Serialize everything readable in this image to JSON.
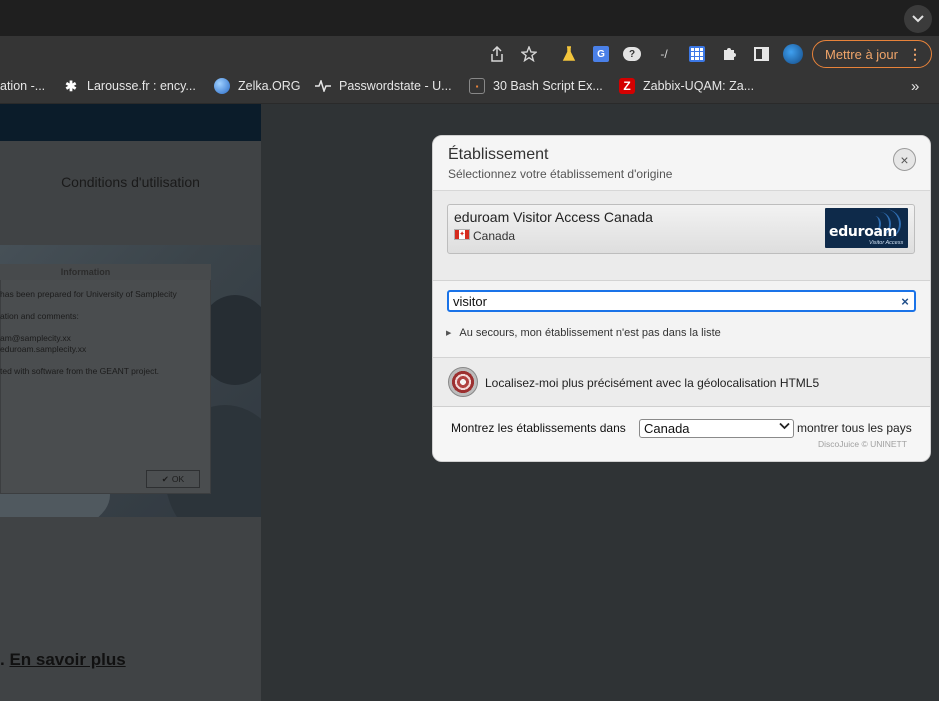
{
  "toolbar": {
    "update_label": "Mettre à jour",
    "icons": [
      "share-icon",
      "star-icon",
      "flask-icon",
      "translate-icon",
      "help-cloud-icon",
      "dash-icon",
      "grid-icon",
      "puzzle-icon",
      "sidepanel-icon",
      "profile-icon"
    ]
  },
  "bookmarks": [
    {
      "label": "ation -...",
      "icon": "none"
    },
    {
      "label": "Larousse.fr : ency...",
      "icon": "asterisk-icon"
    },
    {
      "label": "Zelka.ORG",
      "icon": "globe-icon"
    },
    {
      "label": "Passwordstate - U...",
      "icon": "pulse-icon"
    },
    {
      "label": "30 Bash Script Ex...",
      "icon": "script-icon"
    },
    {
      "label": "Zabbix-UQAM: Za...",
      "icon": "zabbix-icon",
      "fav_text": "Z",
      "color": "#d40000"
    }
  ],
  "bookmarks_more": "»",
  "page": {
    "conditions": "Conditions d'utilisation",
    "info_title": "Information",
    "info_lines": [
      "has been prepared for University of Samplecity",
      "ation and comments:",
      "am@samplecity.xx",
      "eduroam.samplecity.xx",
      "ted with software from the GEANT project."
    ],
    "info_ok": "OK",
    "learn_more_prefix": ". ",
    "learn_more": "En savoir plus"
  },
  "dialog": {
    "title": "Établissement",
    "subtitle": "Sélectionnez votre établissement d'origine",
    "close": "×",
    "result": {
      "name": "eduroam Visitor Access Canada",
      "country": "Canada",
      "logo_text": "eduroam",
      "logo_sub": "Visitor Access"
    },
    "search": {
      "value": "visitor",
      "clear": "×"
    },
    "help_link": "Au secours, mon établissement n'est pas dans la liste",
    "geo_label": "Localisez-moi plus précisément avec la géolocalisation HTML5",
    "show_label": "Montrez les établissements dans",
    "country_selected": "Canada",
    "show_all": "montrer tous les pays",
    "credit": "DiscoJuice © UNINETT"
  },
  "colors": {
    "accent": "#1a73e8",
    "update_orange": "#e8833a",
    "dialog_bg": "#f3f3f3",
    "overlay": "#2f3335"
  }
}
